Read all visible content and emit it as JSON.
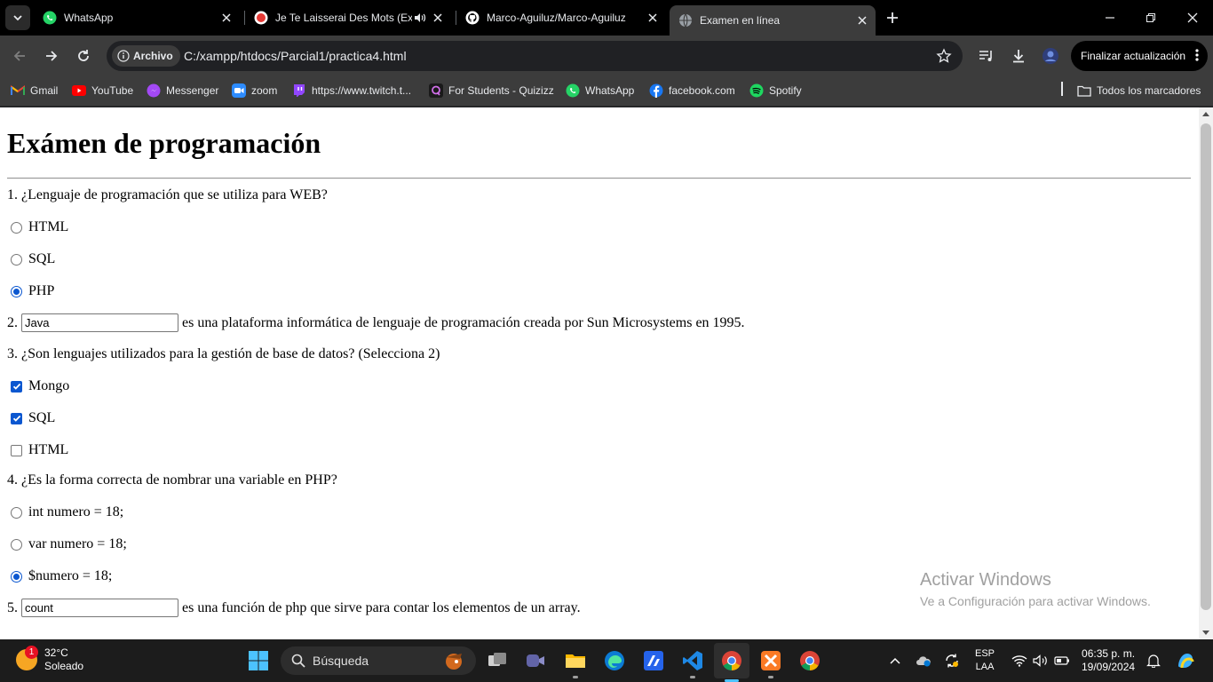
{
  "tabs": [
    {
      "title": "WhatsApp",
      "active": false
    },
    {
      "title": "Je Te Laisserai Des Mots (Ext",
      "active": false,
      "audio": true
    },
    {
      "title": "Marco-Aguiluz/Marco-Aguiluz",
      "active": false
    },
    {
      "title": "Examen en línea",
      "active": true
    }
  ],
  "toolbar": {
    "site_chip": "Archivo",
    "url": "C:/xampp/htdocs/Parcial1/practica4.html",
    "update_button": "Finalizar actualización"
  },
  "bookmarks": {
    "items": [
      {
        "label": "Gmail",
        "icon": "gmail-icon"
      },
      {
        "label": "YouTube",
        "icon": "youtube-icon"
      },
      {
        "label": "Messenger",
        "icon": "messenger-icon"
      },
      {
        "label": "zoom",
        "icon": "zoom-icon"
      },
      {
        "label": "https://www.twitch.t...",
        "icon": "twitch-icon"
      },
      {
        "label": "For Students - Quizizz",
        "icon": "quizizz-icon"
      },
      {
        "label": "WhatsApp",
        "icon": "whatsapp-icon"
      },
      {
        "label": "facebook.com",
        "icon": "facebook-icon"
      },
      {
        "label": "Spotify",
        "icon": "spotify-icon"
      }
    ],
    "all_bookmarks": "Todos los marcadores"
  },
  "page": {
    "heading": "Exámen de programación",
    "q1": {
      "text": "1. ¿Lenguaje de programación que se utiliza para WEB?",
      "options": [
        "HTML",
        "SQL",
        "PHP"
      ],
      "selected": "PHP"
    },
    "q2": {
      "prefix": "2.",
      "value": "Java",
      "suffix": "es una plataforma informática de lenguaje de programación creada por Sun Microsystems en 1995."
    },
    "q3": {
      "text": "3. ¿Son lenguajes utilizados para la gestión de base de datos? (Selecciona 2)",
      "options": [
        "Mongo",
        "SQL",
        "HTML"
      ],
      "checked": [
        "Mongo",
        "SQL"
      ]
    },
    "q4": {
      "text": "4. ¿Es la forma correcta de nombrar una variable en PHP?",
      "options": [
        "int numero = 18;",
        "var numero = 18;",
        "$numero = 18;"
      ],
      "selected": "$numero = 18;"
    },
    "q5": {
      "prefix": "5.",
      "value": "count",
      "suffix": "es una función de php que sirve para contar los elementos de un array."
    }
  },
  "watermark": {
    "line1": "Activar Windows",
    "line2": "Ve a Configuración para activar Windows."
  },
  "taskbar": {
    "weather_temp": "32°C",
    "weather_desc": "Soleado",
    "weather_badge": "1",
    "search_placeholder": "Búsqueda",
    "lang_line1": "ESP",
    "lang_line2": "LAA",
    "time": "06:35 p. m.",
    "date": "19/09/2024"
  },
  "colors": {
    "accent": "#0b57d0",
    "chrome_dark": "#3c3c3c",
    "tabstrip": "#000000"
  }
}
